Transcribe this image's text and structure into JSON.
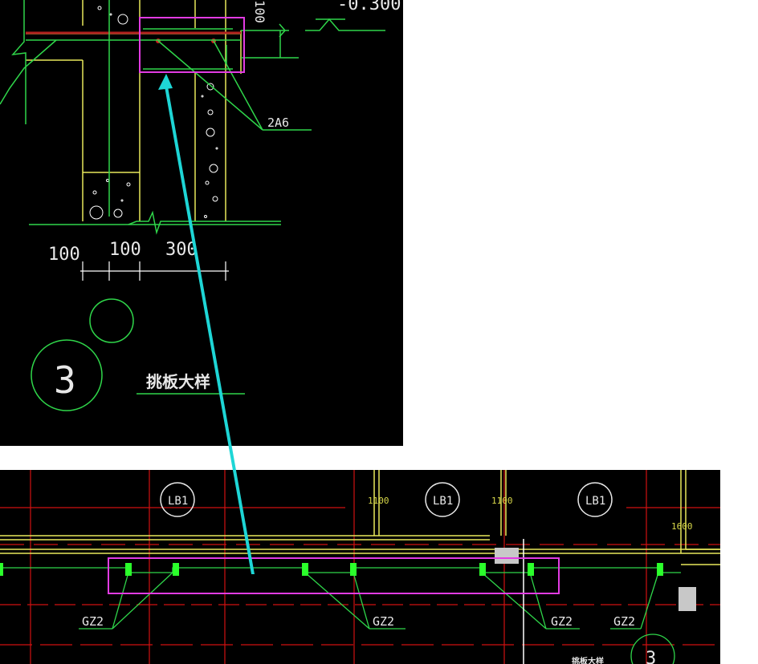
{
  "colors": {
    "background": "#000000",
    "page": "#ffffff",
    "wall": "#e8e85a",
    "rebar": "#2fd64a",
    "beam": "#b0201e",
    "axis": "#d01010",
    "dimension": "#ffffff",
    "label": "#e8e8e8",
    "highlight": "#e23be3",
    "arrow": "#1ed6d6",
    "column_marker": "#2bff2b",
    "gray_block": "#c8c8c8",
    "dim_text_yellow": "#d8d84a"
  },
  "detail": {
    "elevation_label": "-0.300",
    "rebar_label": "2A6",
    "vertical_dim": "100",
    "dims": [
      "100",
      "100",
      "300"
    ],
    "detail_number": "3",
    "detail_title": "挑板大样"
  },
  "plan": {
    "slab_labels": [
      "LB1",
      "LB1",
      "LB1"
    ],
    "dims": [
      "1100",
      "1100",
      "1600"
    ],
    "column_labels": [
      "GZ2",
      "GZ2",
      "GZ2",
      "GZ2"
    ],
    "detail_title": "挑板大样",
    "detail_number": "3"
  }
}
